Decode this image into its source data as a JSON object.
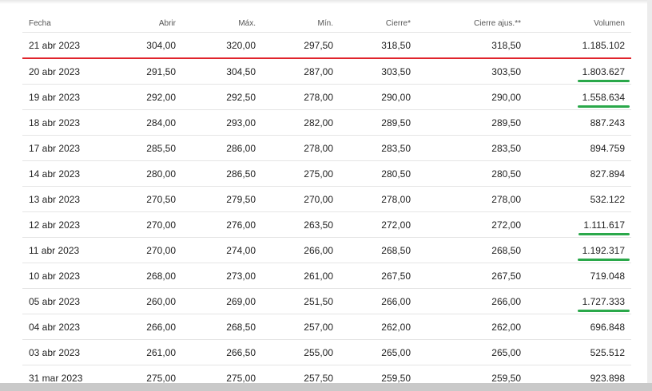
{
  "table": {
    "headers": [
      "Fecha",
      "Abrir",
      "Máx.",
      "Mín.",
      "Cierre*",
      "Cierre ajus.**",
      "Volumen"
    ],
    "rows": [
      {
        "date": "21 abr 2023",
        "open": "304,00",
        "high": "320,00",
        "low": "297,50",
        "close": "318,50",
        "adj_close": "318,50",
        "volume": "1.185.102",
        "highlight": false
      },
      {
        "date": "20 abr 2023",
        "open": "291,50",
        "high": "304,50",
        "low": "287,00",
        "close": "303,50",
        "adj_close": "303,50",
        "volume": "1.803.627",
        "highlight": true
      },
      {
        "date": "19 abr 2023",
        "open": "292,00",
        "high": "292,50",
        "low": "278,00",
        "close": "290,00",
        "adj_close": "290,00",
        "volume": "1.558.634",
        "highlight": true
      },
      {
        "date": "18 abr 2023",
        "open": "284,00",
        "high": "293,00",
        "low": "282,00",
        "close": "289,50",
        "adj_close": "289,50",
        "volume": "887.243",
        "highlight": false
      },
      {
        "date": "17 abr 2023",
        "open": "285,50",
        "high": "286,00",
        "low": "278,00",
        "close": "283,50",
        "adj_close": "283,50",
        "volume": "894.759",
        "highlight": false
      },
      {
        "date": "14 abr 2023",
        "open": "280,00",
        "high": "286,50",
        "low": "275,00",
        "close": "280,50",
        "adj_close": "280,50",
        "volume": "827.894",
        "highlight": false
      },
      {
        "date": "13 abr 2023",
        "open": "270,50",
        "high": "279,50",
        "low": "270,00",
        "close": "278,00",
        "adj_close": "278,00",
        "volume": "532.122",
        "highlight": false
      },
      {
        "date": "12 abr 2023",
        "open": "270,00",
        "high": "276,00",
        "low": "263,50",
        "close": "272,00",
        "adj_close": "272,00",
        "volume": "1.111.617",
        "highlight": true
      },
      {
        "date": "11 abr 2023",
        "open": "270,00",
        "high": "274,00",
        "low": "266,00",
        "close": "268,50",
        "adj_close": "268,50",
        "volume": "1.192.317",
        "highlight": true
      },
      {
        "date": "10 abr 2023",
        "open": "268,00",
        "high": "273,00",
        "low": "261,00",
        "close": "267,50",
        "adj_close": "267,50",
        "volume": "719.048",
        "highlight": false
      },
      {
        "date": "05 abr 2023",
        "open": "260,00",
        "high": "269,00",
        "low": "251,50",
        "close": "266,00",
        "adj_close": "266,00",
        "volume": "1.727.333",
        "highlight": true
      },
      {
        "date": "04 abr 2023",
        "open": "266,00",
        "high": "268,50",
        "low": "257,00",
        "close": "262,00",
        "adj_close": "262,00",
        "volume": "696.848",
        "highlight": false
      },
      {
        "date": "03 abr 2023",
        "open": "261,00",
        "high": "266,50",
        "low": "255,00",
        "close": "265,00",
        "adj_close": "265,00",
        "volume": "525.512",
        "highlight": false
      },
      {
        "date": "31 mar 2023",
        "open": "275,00",
        "high": "275,00",
        "low": "257,50",
        "close": "259,50",
        "adj_close": "259,50",
        "volume": "923.898",
        "highlight": false
      }
    ]
  },
  "colors": {
    "first_row_underline": "#e0242c",
    "volume_highlight": "#2aa84a"
  }
}
